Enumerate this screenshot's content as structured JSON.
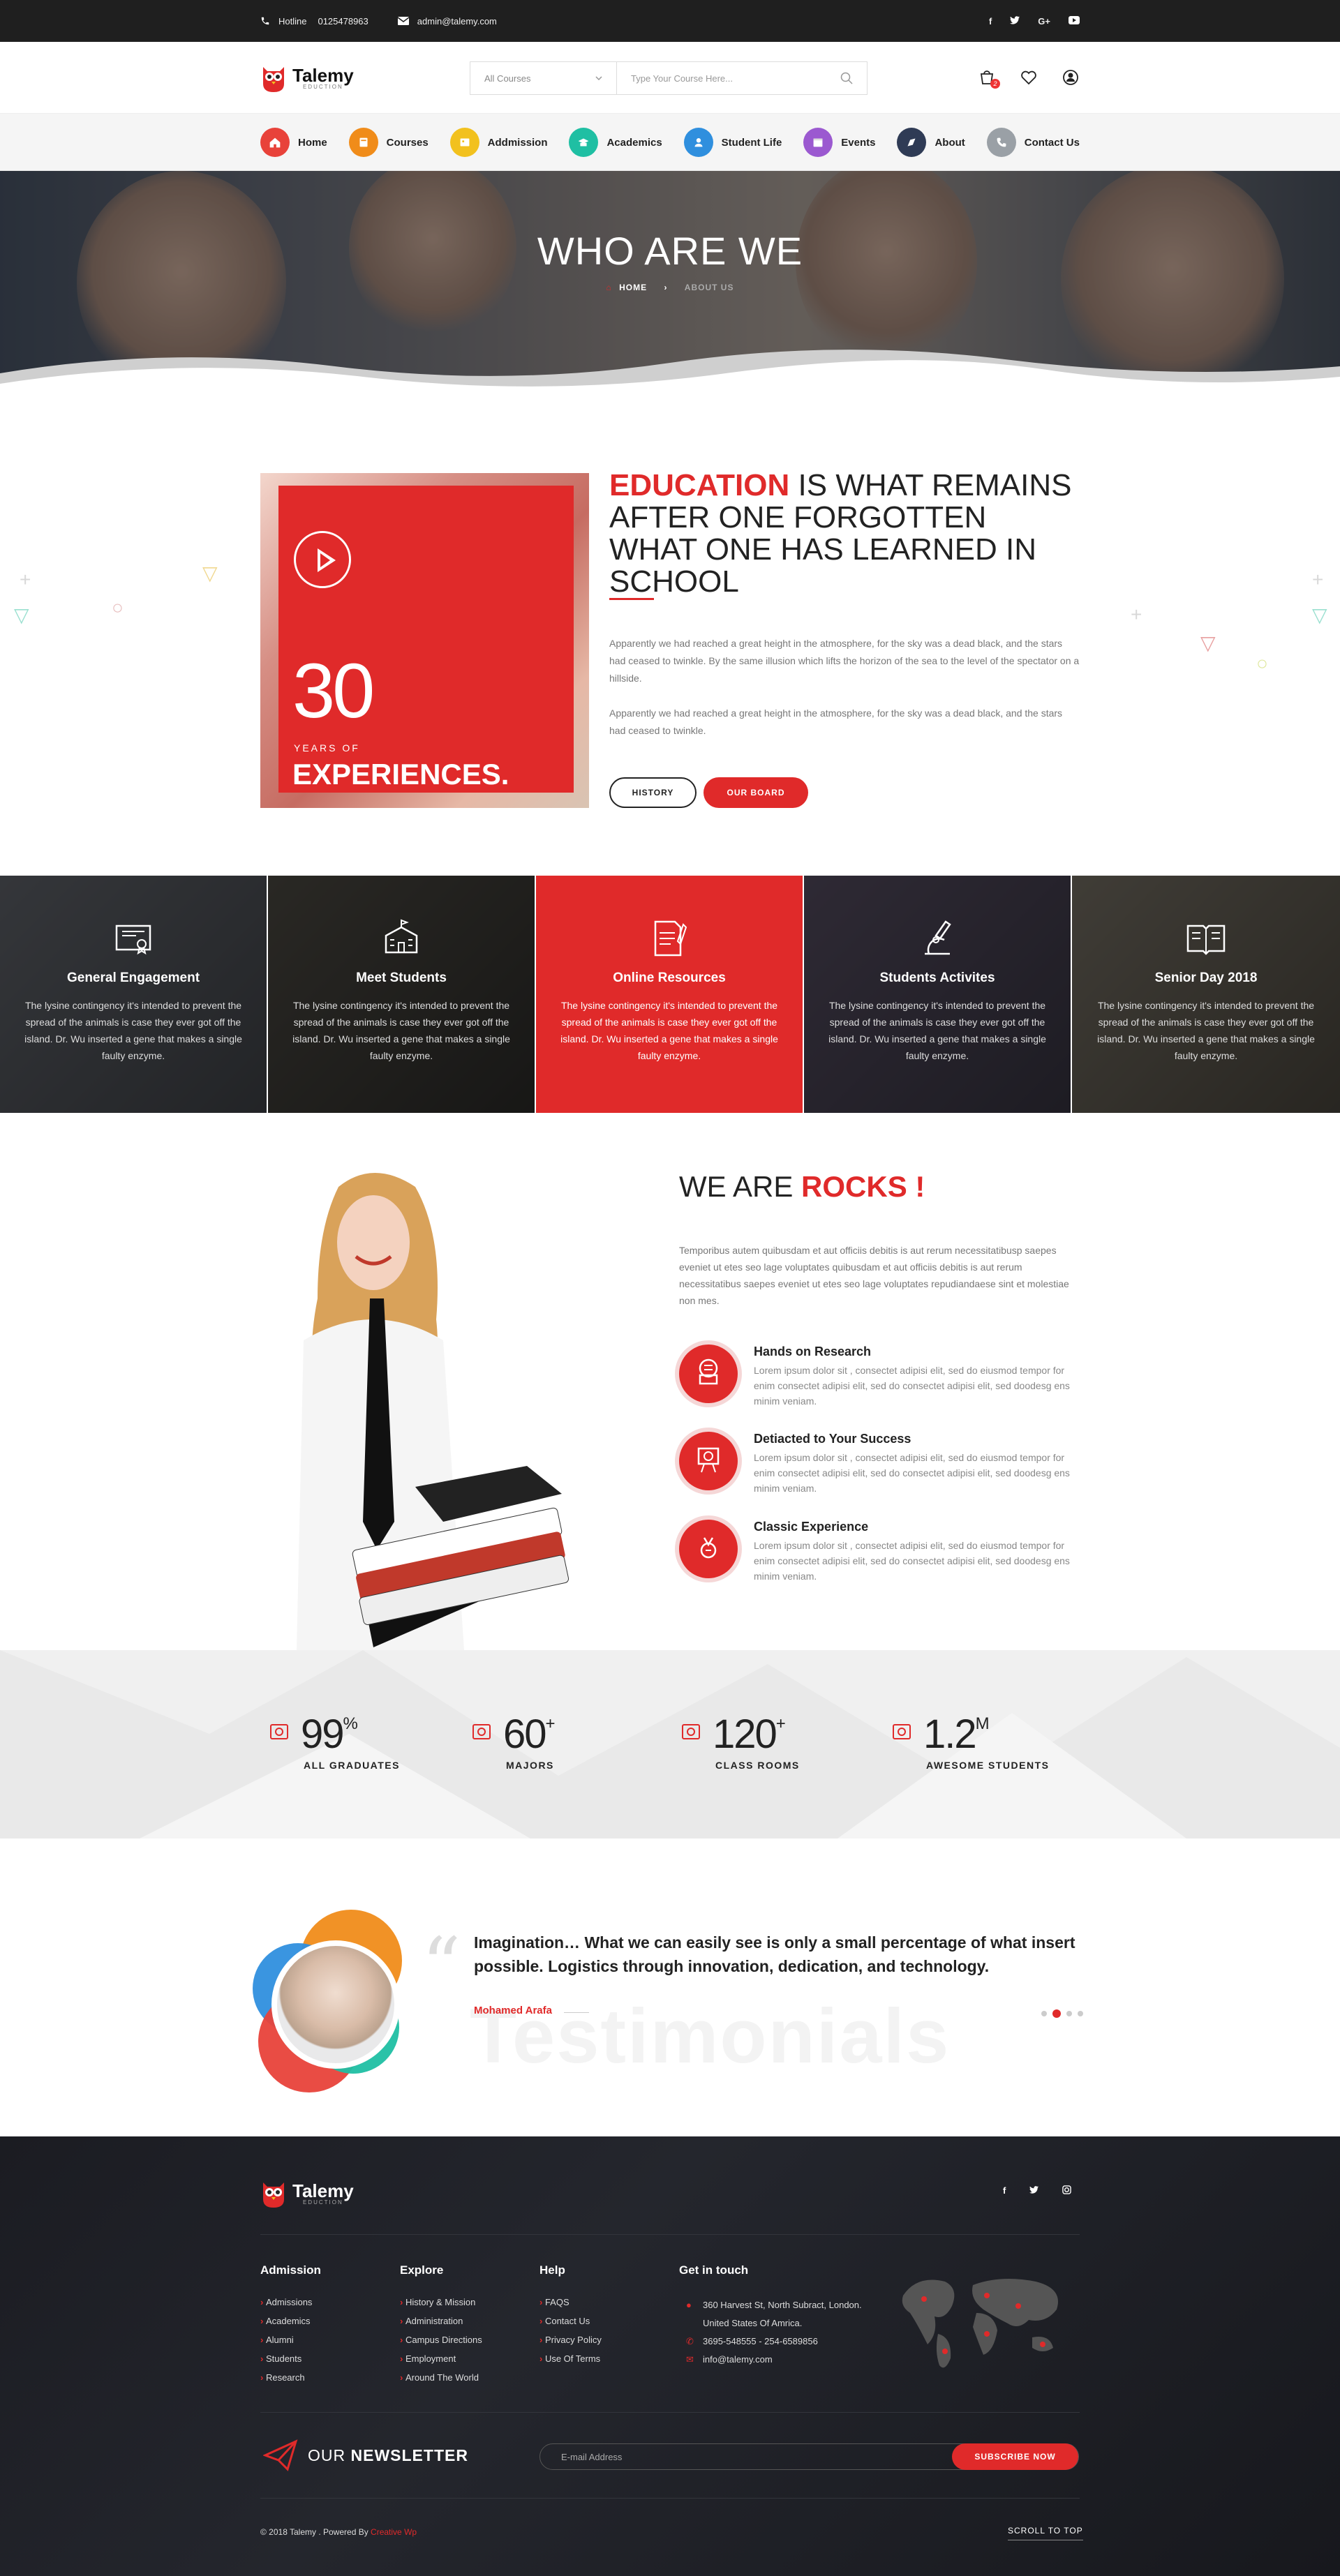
{
  "topbar": {
    "hotline_label": "Hotline",
    "hotline": "0125478963",
    "email": "admin@talemy.com",
    "social": [
      "f",
      "t",
      "G+",
      "yt"
    ]
  },
  "header": {
    "logo_name": "Talemy",
    "logo_sub": "EDUCTION",
    "category_select": "All Courses",
    "search_placeholder": "Type Your Course Here...",
    "cart_count": "2"
  },
  "nav": [
    {
      "label": "Home",
      "color": "#e8423a",
      "icon": "home-icon"
    },
    {
      "label": "Courses",
      "color": "#f08c1a",
      "icon": "courses-icon"
    },
    {
      "label": "Addmission",
      "color": "#f2c11e",
      "icon": "admission-icon"
    },
    {
      "label": "Academics",
      "color": "#1fbfa3",
      "icon": "academics-icon"
    },
    {
      "label": "Student Life",
      "color": "#2f8fde",
      "icon": "student-life-icon"
    },
    {
      "label": "Events",
      "color": "#9b59d0",
      "icon": "events-icon"
    },
    {
      "label": "About",
      "color": "#2f3b55",
      "icon": "about-icon"
    },
    {
      "label": "Contact Us",
      "color": "#9aa0a6",
      "icon": "contact-icon"
    }
  ],
  "hero": {
    "title": "WHO ARE WE",
    "crumb_home": "HOME",
    "crumb_current": "ABOUT US"
  },
  "about": {
    "years": "30",
    "years_of": "YEARS OF",
    "experiences": "EXPERIENCES.",
    "quote_highlight": "EDUCATION",
    "quote_rest": " IS WHAT REMAINS AFTER ONE FORGOTTEN WHAT ONE HAS LEARNED IN SCHOOL",
    "para1": "Apparently we had reached a great height in the atmosphere, for the sky was a dead black, and the stars had ceased to twinkle. By the same illusion which lifts the horizon of the sea to the level of the spectator on a hillside.",
    "para2": "Apparently we had reached a great height in the atmosphere, for the sky was a dead black, and the stars had ceased to twinkle.",
    "btn_history": "HISTORY",
    "btn_board": "OUR BOARD"
  },
  "features": [
    {
      "title": "General Engagement",
      "text": "The lysine contingency it's intended to prevent the spread of the animals is case they ever got off the island. Dr. Wu inserted a gene that makes a single faulty enzyme.",
      "icon": "certificate-icon"
    },
    {
      "title": "Meet Students",
      "text": "The lysine contingency it's intended to prevent the spread of the animals is case they ever got off the island. Dr. Wu inserted a gene that makes a single faulty enzyme.",
      "icon": "school-building-icon"
    },
    {
      "title": "Online Resources",
      "text": "The lysine contingency it's intended to prevent the spread of the animals is case they ever got off the island. Dr. Wu inserted a gene that makes a single faulty enzyme.",
      "icon": "document-pen-icon"
    },
    {
      "title": "Students Activites",
      "text": "The lysine contingency it's intended to prevent the spread of the animals is case they ever got off the island. Dr. Wu inserted a gene that makes a single faulty enzyme.",
      "icon": "microscope-icon"
    },
    {
      "title": "Senior Day 2018",
      "text": "The lysine contingency it's intended to prevent the spread of the animals is case they ever got off the island. Dr. Wu inserted a gene that makes a single faulty enzyme.",
      "icon": "open-book-icon"
    }
  ],
  "rocks": {
    "title_a": "WE ARE ",
    "title_b": "ROCKS !",
    "intro": "Temporibus autem quibusdam et aut officiis debitis is aut rerum necessitatibusp saepes eveniet ut etes seo lage voluptates quibusdam et aut officiis debitis is aut rerum necessitatibus saepes eveniet ut etes seo lage voluptates repudiandaese sint et molestiae non mes.",
    "items": [
      {
        "title": "Hands on Research",
        "text": "Lorem ipsum dolor sit , consectet adipisi elit, sed do eiusmod tempor for enim consectet adipisi elit, sed do consectet adipisi elit, sed doodesg ens minim veniam.",
        "icon": "research-icon"
      },
      {
        "title": "Detiacted to Your Success",
        "text": "Lorem ipsum dolor sit , consectet adipisi elit, sed do eiusmod tempor for enim consectet adipisi elit, sed do consectet adipisi elit, sed doodesg ens minim veniam.",
        "icon": "trophy-icon"
      },
      {
        "title": "Classic Experience",
        "text": "Lorem ipsum dolor sit , consectet adipisi elit, sed do eiusmod tempor for enim consectet adipisi elit, sed do consectet adipisi elit, sed doodesg ens minim veniam.",
        "icon": "medal-icon"
      }
    ]
  },
  "stats": [
    {
      "num": "99",
      "suffix": "%",
      "label": "ALL GRADUATES",
      "icon": "graduate-icon"
    },
    {
      "num": "60",
      "suffix": "+",
      "label": "MAJORS",
      "icon": "majors-icon"
    },
    {
      "num": "120",
      "suffix": "+",
      "label": "CLASS ROOMS",
      "icon": "classroom-icon"
    },
    {
      "num": "1.2",
      "suffix": "M",
      "label": "AWESOME STUDENTS",
      "icon": "students-icon"
    }
  ],
  "testimonial": {
    "text": "Imagination… What we can easily see is only a small percentage of what insert possible. Logistics through innovation, dedication, and technology.",
    "name": "Mohamed Arafa",
    "bg_word": "Testimonials",
    "dots": 4,
    "active_dot": 1
  },
  "footer": {
    "logo_name": "Talemy",
    "logo_sub": "EDUCTION",
    "social": [
      "f",
      "t",
      "ig"
    ],
    "cols": [
      {
        "title": "Admission",
        "items": [
          "Admissions",
          "Academics",
          "Alumni",
          "Students",
          "Research"
        ]
      },
      {
        "title": "Explore",
        "items": [
          "History & Mission",
          "Administration",
          "Campus Directions",
          "Employment",
          "Around The World"
        ]
      },
      {
        "title": "Help",
        "items": [
          "FAQS",
          "Contact Us",
          "Privacy Policy",
          "Use Of Terms"
        ]
      }
    ],
    "contact_title": "Get in touch",
    "address1": "360 Harvest St, North Subract, London.",
    "address2": "United States Of Amrica.",
    "phone": "3695-548555   -   254-6589856",
    "email": "info@talemy.com",
    "newsletter_a": "OUR ",
    "newsletter_b": "NEWSLETTER",
    "email_placeholder": "E-mail Address",
    "subscribe": "SUBSCRIBE NOW",
    "copyright": "© 2018 Talemy .  Powered By ",
    "powered_by": "Creative Wp",
    "scroll_top": "SCROLL TO TOP"
  },
  "colors": {
    "accent": "#e02a2a",
    "dark": "#1f1f1f"
  }
}
